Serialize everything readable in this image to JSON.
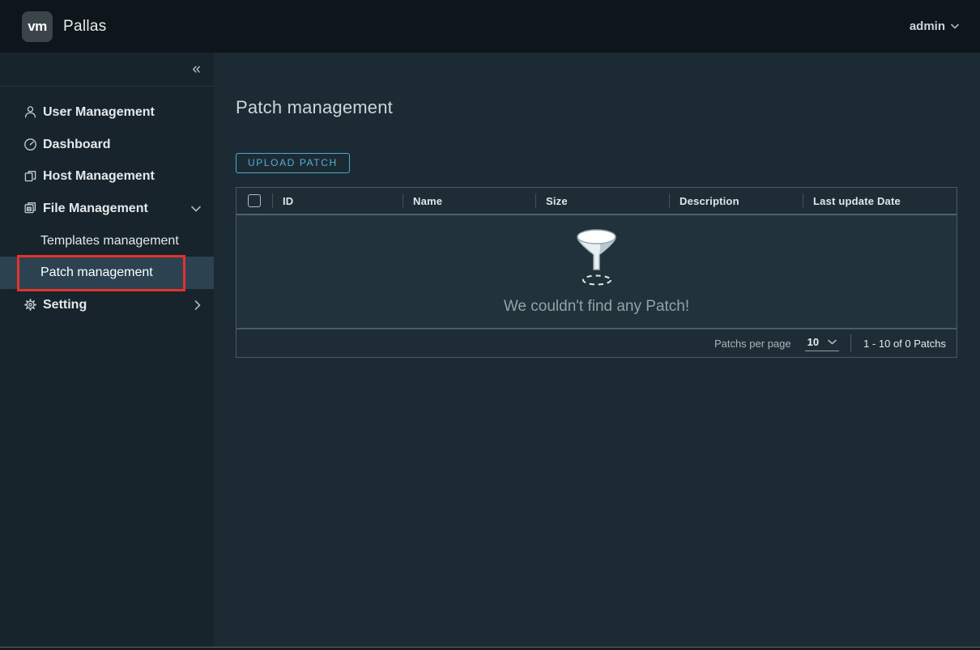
{
  "header": {
    "logo_text": "vm",
    "app_name": "Pallas",
    "user_menu_label": "admin"
  },
  "sidebar": {
    "collapse_glyph": "«",
    "items": [
      {
        "label": "User Management",
        "icon": "user-icon"
      },
      {
        "label": "Dashboard",
        "icon": "dashboard-icon"
      },
      {
        "label": "Host Management",
        "icon": "host-icon"
      },
      {
        "label": "File Management",
        "icon": "files-icon",
        "state": "expanded",
        "children": [
          {
            "label": "Templates management",
            "active": false
          },
          {
            "label": "Patch management",
            "active": true
          }
        ]
      },
      {
        "label": "Setting",
        "icon": "gear-icon",
        "state": "collapsed"
      }
    ]
  },
  "main": {
    "title": "Patch management",
    "upload_button": "UPLOAD PATCH",
    "table": {
      "columns": [
        "ID",
        "Name",
        "Size",
        "Description",
        "Last update Date"
      ],
      "rows": [],
      "empty_message": "We couldn't find any Patch!",
      "footer": {
        "per_page_label": "Patchs per page",
        "per_page_value": "10",
        "range_label": "1 - 10 of 0 Patchs"
      }
    }
  },
  "icons": {
    "collapse": "double-chevron-left",
    "user_dropdown": "chevron-down",
    "file_group": "chevron-down",
    "setting_group": "chevron-right",
    "empty_state": "funnel-icon"
  },
  "annotation": {
    "color": "#e6312b",
    "target": "Patch management sidebar item"
  },
  "colors": {
    "header_bg": "#0e161c",
    "sidebar_bg": "#17242b",
    "content_bg": "#1c2b33",
    "active_nav_bg": "#2c4251",
    "accent_blue": "#49afd9",
    "grid_band_bg": "#1e2d35",
    "grid_empty_bg": "#22323a"
  }
}
